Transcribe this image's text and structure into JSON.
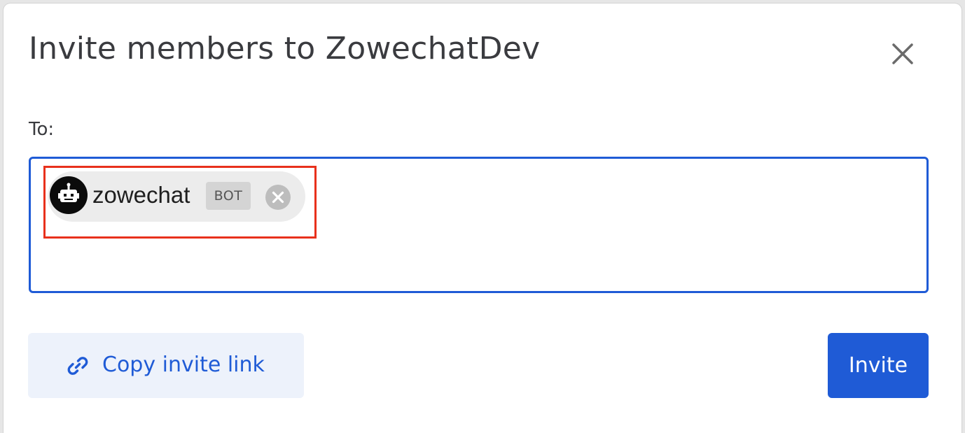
{
  "dialog": {
    "title": "Invite members to ZowechatDev",
    "close_icon": "close-icon"
  },
  "recipients": {
    "label": "To:",
    "chips": [
      {
        "name": "zowechat",
        "badge": "BOT",
        "avatar_icon": "robot-icon",
        "remove_icon": "remove-circle-icon"
      }
    ]
  },
  "footer": {
    "copy_link_label": "Copy invite link",
    "copy_link_icon": "link-icon",
    "invite_label": "Invite"
  },
  "colors": {
    "accent": "#1f5bd6",
    "highlight": "#e8311c",
    "copy_link_bg": "#edf2fb",
    "chip_bg": "#ececec"
  }
}
